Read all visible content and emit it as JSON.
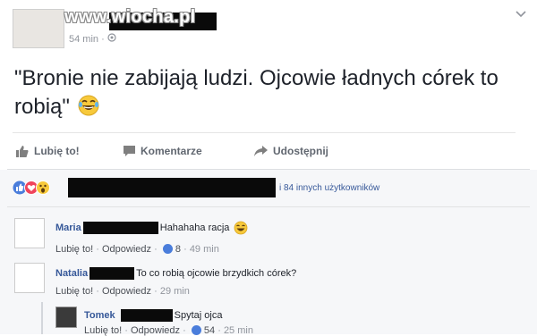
{
  "post": {
    "watermark": "www.wiocha.pl",
    "time": "54 min ·",
    "text": "\"Bronie nie zabijają ludzi. Ojcowie ładnych córek to robią\""
  },
  "actions": {
    "like": "Lubię to!",
    "comment": "Komentarze",
    "share": "Udostępnij"
  },
  "reactions": {
    "others": "i 84 innych użytkowników"
  },
  "comments": [
    {
      "name": "Maria",
      "text": "Hahahaha racja",
      "like": "Lubię to!",
      "reply": "Odpowiedz",
      "sep": "·",
      "count": "8",
      "time": "· 49 min"
    },
    {
      "name": "Natalia",
      "text": "To co robią ojcowie brzydkich córek?",
      "like": "Lubię to!",
      "reply": "Odpowiedz",
      "sep": "·",
      "time": "· 29 min"
    }
  ],
  "reply": {
    "name": "Tomek",
    "text": "Spytaj ojca",
    "like": "Lubię to!",
    "reply": "Odpowiedz",
    "count": "54",
    "time": "· 25 min"
  },
  "colors": {
    "link": "#365899",
    "meta": "#90949c",
    "redaction": "#0a0a0a"
  }
}
